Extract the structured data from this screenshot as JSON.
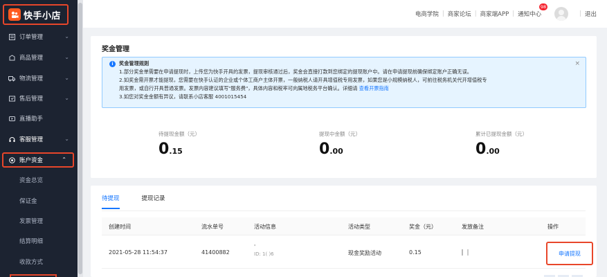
{
  "brand": {
    "name": "快手小店",
    "accent": "#e8462a"
  },
  "sidebar": {
    "items": [
      {
        "label": "订单管理",
        "icon": "order-icon"
      },
      {
        "label": "商品管理",
        "icon": "goods-icon"
      },
      {
        "label": "物流管理",
        "icon": "truck-icon"
      },
      {
        "label": "售后管理",
        "icon": "aftersale-icon"
      },
      {
        "label": "直播助手",
        "icon": "live-icon"
      },
      {
        "label": "客服管理",
        "icon": "service-icon"
      },
      {
        "label": "账户资金",
        "icon": "wallet-icon"
      }
    ],
    "sub_items": [
      "资金总览",
      "保证金",
      "发票管理",
      "结算明细",
      "收款方式"
    ]
  },
  "header": {
    "links": [
      "电商学院",
      "商家论坛",
      "商家端APP",
      "通知中心"
    ],
    "notify_count": "98",
    "logout": "退出"
  },
  "main": {
    "card_title": "奖金管理",
    "notice": {
      "title": "奖金管理规则",
      "lines": [
        "1.部分奖金单需要在申请提现时，上传您为快手开具的发票，提现审核通过后，奖金会直接打款到您绑定的提现账户中。请在申请提现前确保绑定账户正确无误。",
        "2.如奖金需开票才能提现，您需要在快手认证的企业或个体工商户主体开票，一般纳税人请开具增值税专用发票，如果您是小规模纳税人，可前往税务机关代开增值税专",
        "用发票，或自行开具普通发票。发票内容建议填写\"服务费\"，具体内容和税率可向属地税务平台确认。详细请",
        "3.如您对奖金金额有异议，请联系小店客服 4001015454"
      ],
      "link_text": "查看开票指南"
    },
    "stats": [
      {
        "label": "待提现金额（元）",
        "int": "0",
        "dec": ".15"
      },
      {
        "label": "提现中金额（元）",
        "int": "0",
        "dec": ".00"
      },
      {
        "label": "累计已提现金额（元）",
        "int": "0",
        "dec": ".00"
      }
    ]
  },
  "withdraw": {
    "tabs": [
      "待提现",
      "提现记录"
    ],
    "columns": [
      "创建时间",
      "流水单号",
      "活动信息",
      "活动类型",
      "奖金（元）",
      "发放备注",
      "操作"
    ],
    "rows": [
      {
        "created": "2021-05-28 11:54:37",
        "serial": "41400882",
        "activity_name": "'",
        "activity_id": "ID: 1(     )6",
        "type": "现金奖励活动",
        "amount": "0.15",
        "remark": "",
        "action": "申请提现"
      }
    ]
  }
}
